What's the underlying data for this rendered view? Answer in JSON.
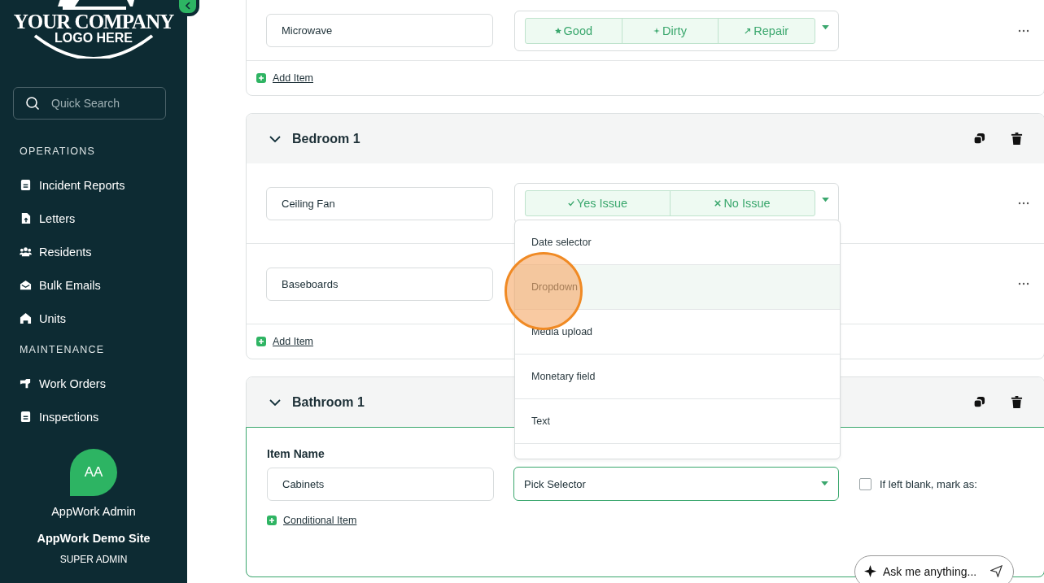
{
  "sidebar": {
    "logo": {
      "line1": "YOUR COMPANY",
      "line2": "LOGO HERE"
    },
    "search": {
      "placeholder": "Quick Search"
    },
    "groups": [
      {
        "title": "OPERATIONS",
        "items": [
          {
            "label": "Incident Reports"
          },
          {
            "label": "Letters"
          },
          {
            "label": "Residents"
          },
          {
            "label": "Bulk Emails"
          },
          {
            "label": "Units"
          }
        ]
      },
      {
        "title": "MAINTENANCE",
        "items": [
          {
            "label": "Work Orders"
          },
          {
            "label": "Inspections"
          }
        ]
      }
    ],
    "user": {
      "initials": "AA",
      "name": "AppWork Admin",
      "site": "AppWork Demo Site",
      "role": "SUPER ADMIN"
    }
  },
  "sections": [
    {
      "items": [
        {
          "name": "Microwave",
          "options": [
            {
              "label": "Good"
            },
            {
              "label": "Dirty"
            },
            {
              "label": "Repair"
            }
          ]
        }
      ],
      "add_label": "Add Item"
    },
    {
      "title": "Bedroom 1",
      "expanded": true,
      "items": [
        {
          "name": "Ceiling Fan",
          "options": [
            {
              "label": "Yes Issue"
            },
            {
              "label": "No Issue"
            }
          ],
          "dropdown": {
            "options": [
              {
                "label": "Date selector",
                "selected": false
              },
              {
                "label": "Dropdown",
                "selected": true
              },
              {
                "label": "Media upload",
                "selected": false
              },
              {
                "label": "Monetary field",
                "selected": false
              },
              {
                "label": "Text",
                "selected": false
              }
            ]
          }
        },
        {
          "name": "Baseboards"
        }
      ],
      "add_label": "Add Item"
    },
    {
      "title": "Bathroom 1",
      "expanded": true,
      "editor": {
        "label": "Item Name",
        "value": "Cabinets",
        "selector": "Pick Selector",
        "blank_label": "If left blank, mark as:",
        "blank_checked": false,
        "conditional_label": "Conditional Item"
      }
    }
  ],
  "assistant": {
    "placeholder": "Ask me anything..."
  }
}
